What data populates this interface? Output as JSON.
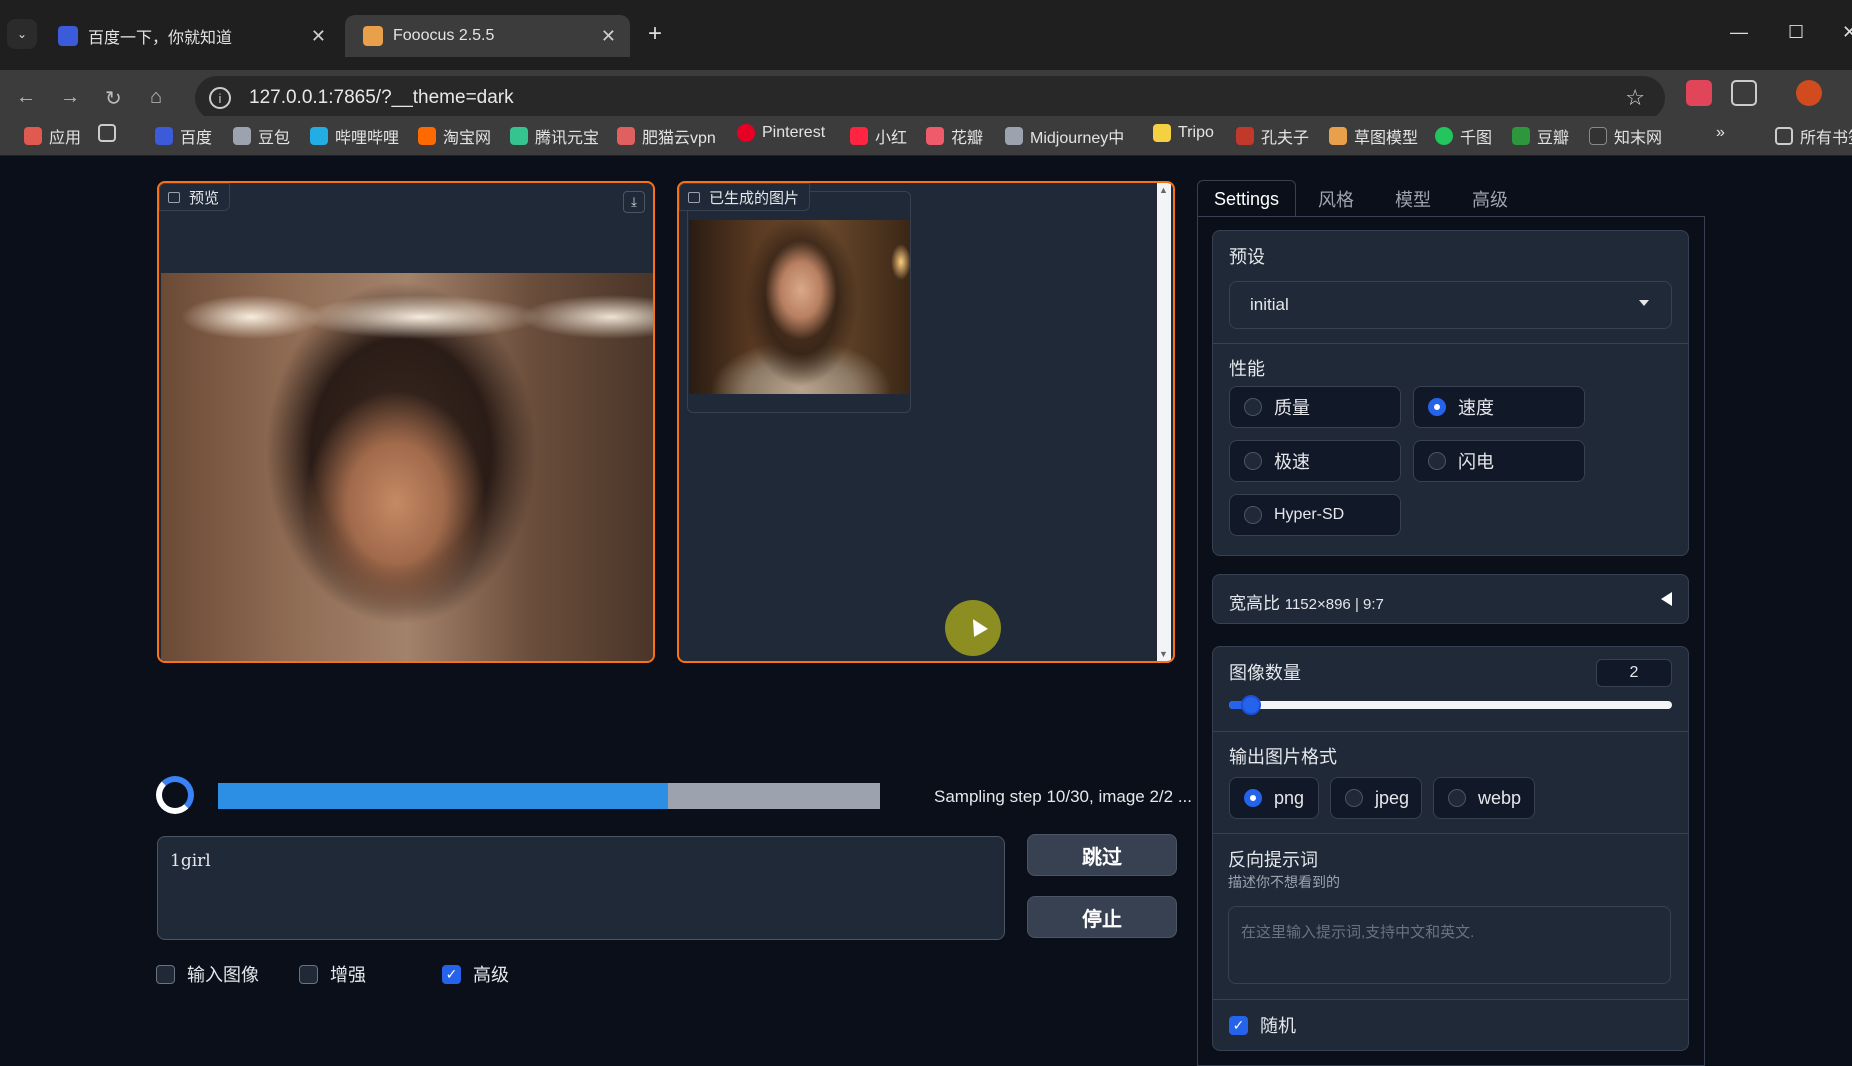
{
  "browser": {
    "tabs": [
      {
        "title": "百度一下，你就知道",
        "favicon_color": "#3b5bdb"
      },
      {
        "title": "Fooocus 2.5.5",
        "favicon_color": "#e8a04a"
      }
    ],
    "address": "127.0.0.1:7865/?__theme=dark",
    "bookmarks": [
      {
        "label": "应用",
        "color": "#e05a4f"
      },
      {
        "label": "百度",
        "color": "#3b5bdb"
      },
      {
        "label": "豆包",
        "color": "#9ca3af"
      },
      {
        "label": "哔哩哔哩",
        "color": "#23ade5"
      },
      {
        "label": "淘宝网",
        "color": "#ff6a00"
      },
      {
        "label": "腾讯元宝",
        "color": "#35c38f"
      },
      {
        "label": "肥猫云vpn",
        "color": "#e06060"
      },
      {
        "label": "Pinterest",
        "color": "#e60023"
      },
      {
        "label": "小红",
        "color": "#ff2442"
      },
      {
        "label": "花瓣",
        "color": "#ef5b6a"
      },
      {
        "label": "Midjourney中",
        "color": "#9ca3af"
      },
      {
        "label": "Tripo",
        "color": "#f5d142"
      },
      {
        "label": "孔夫子",
        "color": "#c0392b"
      },
      {
        "label": "草图模型",
        "color": "#e8a04a"
      },
      {
        "label": "千图",
        "color": "#22c55e"
      },
      {
        "label": "豆瓣",
        "color": "#2e963d"
      },
      {
        "label": "知末网",
        "color": "#333333"
      }
    ],
    "all_bookmarks": "所有书签"
  },
  "app": {
    "preview_label": "预览",
    "gallery_label": "已生成的图片",
    "progress": {
      "fraction": 0.68,
      "text": "Sampling step 10/30, image 2/2 ..."
    },
    "prompt_value": "1girl",
    "skip_label": "跳过",
    "stop_label": "停止",
    "options": [
      {
        "label": "输入图像",
        "checked": false
      },
      {
        "label": "增强",
        "checked": false
      },
      {
        "label": "高级",
        "checked": true
      }
    ]
  },
  "settings": {
    "tabs": [
      "Settings",
      "风格",
      "模型",
      "高级"
    ],
    "active_tab": "Settings",
    "preset_label": "预设",
    "preset_value": "initial",
    "performance_label": "性能",
    "performance_options": [
      {
        "label": "质量",
        "selected": false
      },
      {
        "label": "速度",
        "selected": true
      },
      {
        "label": "极速",
        "selected": false
      },
      {
        "label": "闪电",
        "selected": false
      },
      {
        "label": "Hyper-SD",
        "selected": false
      }
    ],
    "aspect_label": "宽高比",
    "aspect_value": "1152×896 | 9:7",
    "image_count_label": "图像数量",
    "image_count_value": "2",
    "image_count_fraction": 0.05,
    "format_label": "输出图片格式",
    "format_options": [
      {
        "label": "png",
        "selected": true
      },
      {
        "label": "jpeg",
        "selected": false
      },
      {
        "label": "webp",
        "selected": false
      }
    ],
    "negative_label": "反向提示词",
    "negative_hint": "描述你不想看到的",
    "negative_placeholder": "在这里输入提示词,支持中文和英文.",
    "random_label": "随机",
    "random_checked": true
  }
}
